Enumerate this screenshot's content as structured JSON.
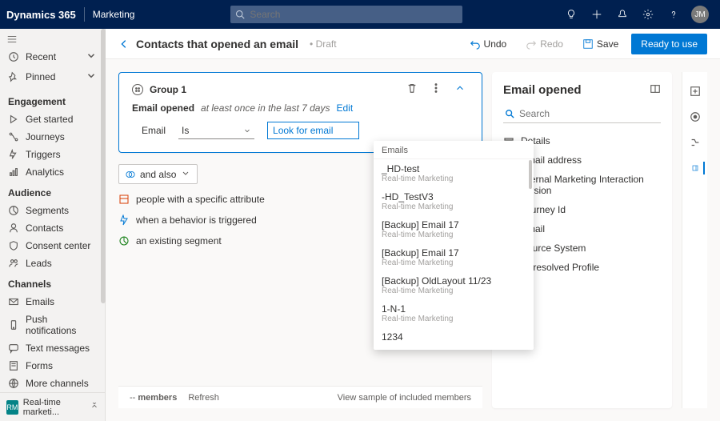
{
  "topbar": {
    "product": "Dynamics 365",
    "module": "Marketing",
    "search_placeholder": "Search",
    "avatar_initials": "JM"
  },
  "sidebar": {
    "recent": "Recent",
    "pinned": "Pinned",
    "groups": [
      {
        "title": "Engagement",
        "items": [
          "Get started",
          "Journeys",
          "Triggers",
          "Analytics"
        ]
      },
      {
        "title": "Audience",
        "items": [
          "Segments",
          "Contacts",
          "Consent center",
          "Leads"
        ]
      },
      {
        "title": "Channels",
        "items": [
          "Emails",
          "Push notifications",
          "Text messages",
          "Forms",
          "More channels"
        ]
      }
    ],
    "footer_badge": "RM",
    "footer_label": "Real-time marketi..."
  },
  "cmdbar": {
    "title": "Contacts that opened an email",
    "status": "Draft",
    "undo": "Undo",
    "redo": "Redo",
    "save": "Save",
    "primary": "Ready to use"
  },
  "group": {
    "name": "Group 1",
    "behavior_label": "Email opened",
    "behavior_desc": "at least once in the last 7 days",
    "edit": "Edit",
    "attr_label": "Email",
    "op_label": "Is",
    "lookup_placeholder": "Look for email"
  },
  "also_label": "and also",
  "add_options": [
    "people with a specific attribute",
    "when a behavior is triggered",
    "an existing segment"
  ],
  "flyout": {
    "header": "Emails",
    "items": [
      {
        "name": "_HD-test",
        "sub": "Real-time Marketing"
      },
      {
        "name": "-HD_TestV3",
        "sub": "Real-time Marketing"
      },
      {
        "name": "[Backup] Email 17",
        "sub": "Real-time Marketing"
      },
      {
        "name": "[Backup] Email 17",
        "sub": "Real-time Marketing"
      },
      {
        "name": "[Backup] OldLayout 11/23",
        "sub": "Real-time Marketing"
      },
      {
        "name": "1-N-1",
        "sub": "Real-time Marketing"
      },
      {
        "name": "1234",
        "sub": ""
      }
    ]
  },
  "panel": {
    "title": "Email opened",
    "search_placeholder": "Search",
    "attrs": [
      "Details",
      "Email address",
      "Internal Marketing Interaction Version",
      "Journey Id",
      "Email",
      "Source System",
      "Unresolved Profile"
    ]
  },
  "footer": {
    "members_prefix": "--",
    "members_label": "members",
    "refresh": "Refresh",
    "sample": "View sample of included members"
  }
}
